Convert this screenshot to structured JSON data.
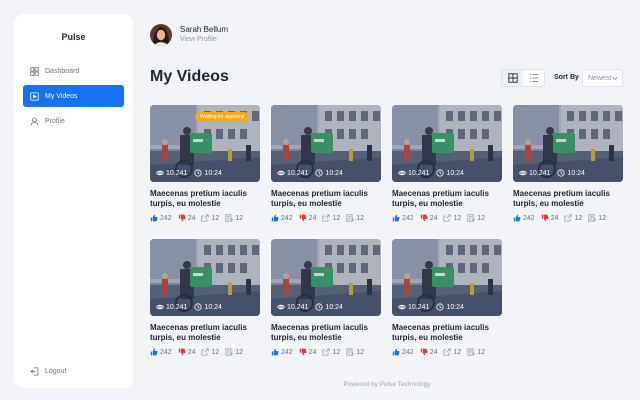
{
  "app": {
    "brand": "Pulse"
  },
  "sidebar": {
    "items": [
      {
        "label": "Dashboard",
        "icon": "dashboard-icon",
        "active": false
      },
      {
        "label": "My Videos",
        "icon": "video-icon",
        "active": true
      },
      {
        "label": "Profile",
        "icon": "user-icon",
        "active": false
      }
    ],
    "logout_label": "Logout"
  },
  "user": {
    "name": "Sarah Bellum",
    "link": "View Profile"
  },
  "main": {
    "title": "My Videos",
    "sort_label": "Sort By",
    "sort_value": "Newest"
  },
  "colors": {
    "accent": "#1672f3",
    "badge": "#f6a81c",
    "like": "#1672f3",
    "dislike": "#e53935"
  },
  "videos": [
    {
      "title": "Maecenas pretium iaculis turpis, eu molestie",
      "views": "10.241",
      "duration": "10:24",
      "likes": "242",
      "dislikes": "24",
      "shares": "12",
      "saves": "12",
      "badge": "Waiting for approval"
    },
    {
      "title": "Maecenas pretium iaculis turpis, eu molestie",
      "views": "10.241",
      "duration": "10:24",
      "likes": "242",
      "dislikes": "24",
      "shares": "12",
      "saves": "12"
    },
    {
      "title": "Maecenas pretium iaculis turpis, eu molestie",
      "views": "10.241",
      "duration": "10:24",
      "likes": "242",
      "dislikes": "24",
      "shares": "12",
      "saves": "12"
    },
    {
      "title": "Maecenas pretium iaculis turpis, eu molestie",
      "views": "10.241",
      "duration": "10:24",
      "likes": "242",
      "dislikes": "24",
      "shares": "12",
      "saves": "12"
    },
    {
      "title": "Maecenas pretium iaculis turpis, eu molestie",
      "views": "10.241",
      "duration": "10:24",
      "likes": "242",
      "dislikes": "24",
      "shares": "12",
      "saves": "12"
    },
    {
      "title": "Maecenas pretium iaculis turpis, eu molestie",
      "views": "10.241",
      "duration": "10:24",
      "likes": "242",
      "dislikes": "24",
      "shares": "12",
      "saves": "12"
    },
    {
      "title": "Maecenas pretium iaculis turpis, eu molestie",
      "views": "10.241",
      "duration": "10:24",
      "likes": "242",
      "dislikes": "24",
      "shares": "12",
      "saves": "12"
    }
  ],
  "footer": "Powered by Pulse Technology"
}
